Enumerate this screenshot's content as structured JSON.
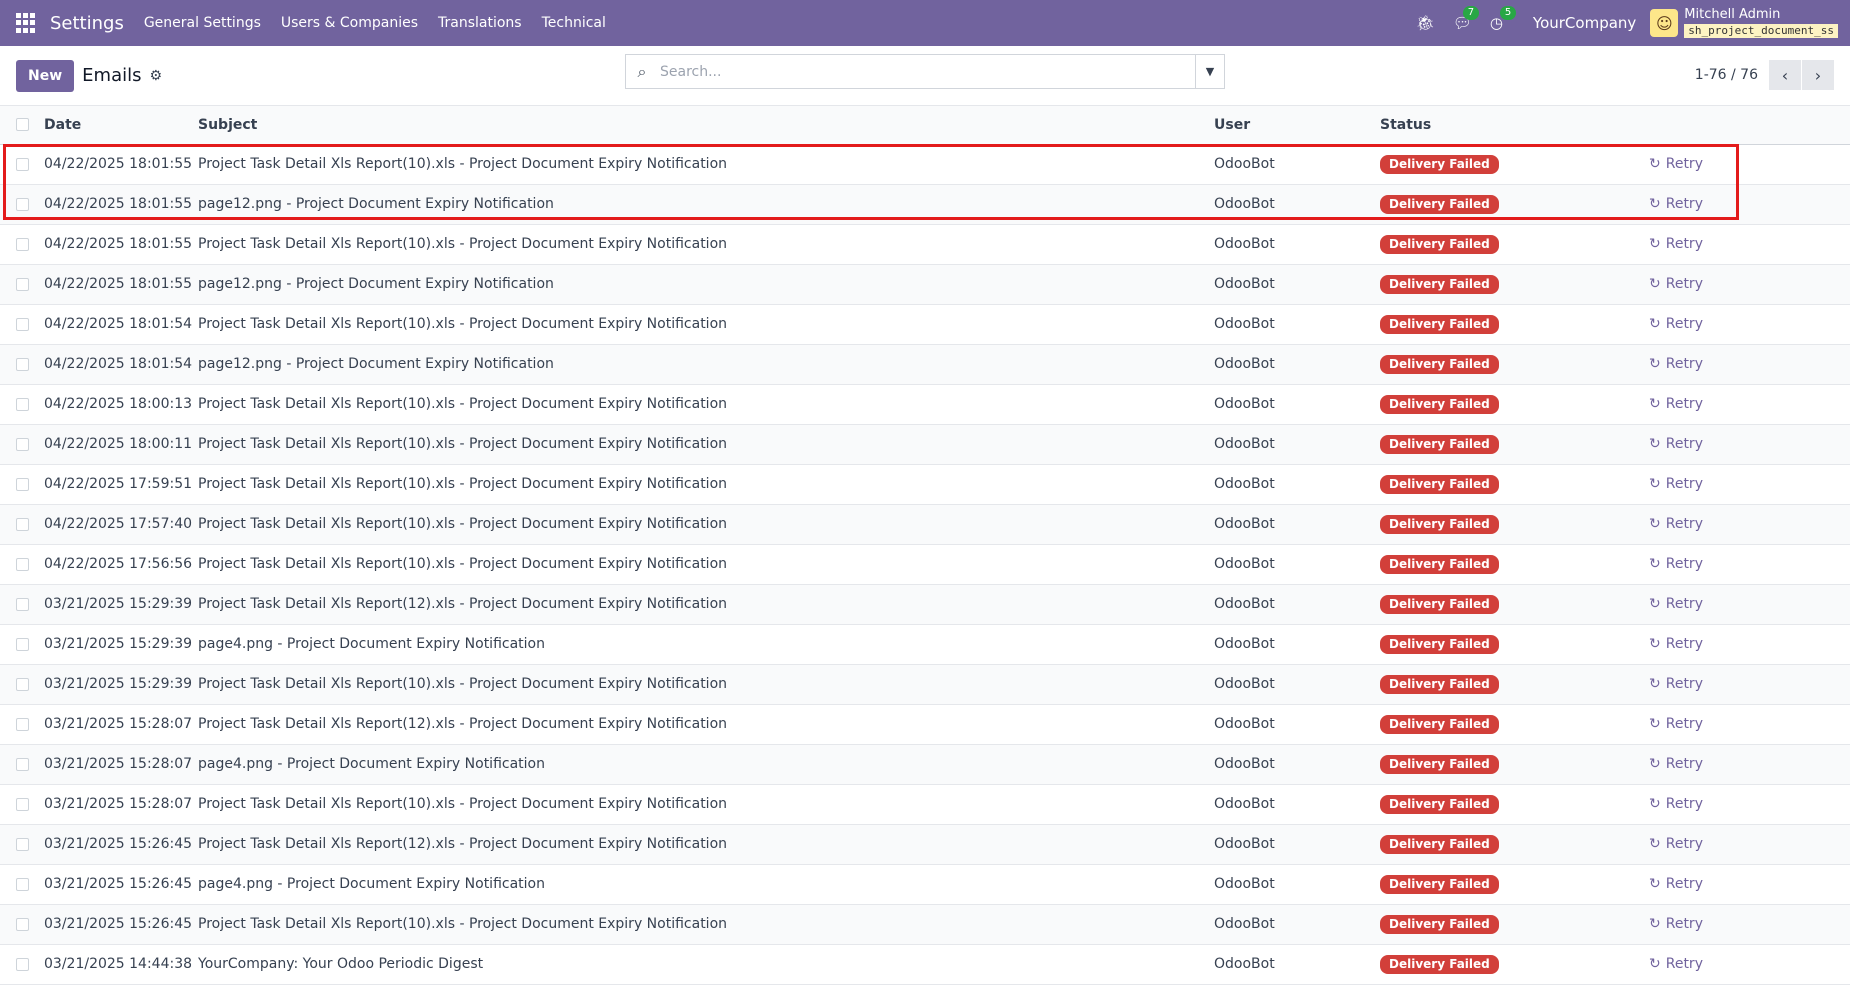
{
  "navbar": {
    "app_title": "Settings",
    "menu": [
      "General Settings",
      "Users & Companies",
      "Translations",
      "Technical"
    ],
    "chat_count": "7",
    "activity_count": "5",
    "company": "YourCompany",
    "user_name": "Mitchell Admin",
    "db_name": "sh_project_document_ss"
  },
  "control": {
    "new_label": "New",
    "title": "Emails",
    "search_placeholder": "Search...",
    "pager": "1-76 / 76"
  },
  "columns": {
    "date": "Date",
    "subject": "Subject",
    "user": "User",
    "status": "Status"
  },
  "rows": [
    {
      "date": "04/22/2025 18:01:55",
      "subject": "Project Task Detail Xls Report(10).xls - Project Document Expiry Notification",
      "user": "OdooBot",
      "status": "Delivery Failed",
      "action": "Retry"
    },
    {
      "date": "04/22/2025 18:01:55",
      "subject": "page12.png - Project Document Expiry Notification",
      "user": "OdooBot",
      "status": "Delivery Failed",
      "action": "Retry"
    },
    {
      "date": "04/22/2025 18:01:55",
      "subject": "Project Task Detail Xls Report(10).xls - Project Document Expiry Notification",
      "user": "OdooBot",
      "status": "Delivery Failed",
      "action": "Retry"
    },
    {
      "date": "04/22/2025 18:01:55",
      "subject": "page12.png - Project Document Expiry Notification",
      "user": "OdooBot",
      "status": "Delivery Failed",
      "action": "Retry"
    },
    {
      "date": "04/22/2025 18:01:54",
      "subject": "Project Task Detail Xls Report(10).xls - Project Document Expiry Notification",
      "user": "OdooBot",
      "status": "Delivery Failed",
      "action": "Retry"
    },
    {
      "date": "04/22/2025 18:01:54",
      "subject": "page12.png - Project Document Expiry Notification",
      "user": "OdooBot",
      "status": "Delivery Failed",
      "action": "Retry"
    },
    {
      "date": "04/22/2025 18:00:13",
      "subject": "Project Task Detail Xls Report(10).xls - Project Document Expiry Notification",
      "user": "OdooBot",
      "status": "Delivery Failed",
      "action": "Retry"
    },
    {
      "date": "04/22/2025 18:00:11",
      "subject": "Project Task Detail Xls Report(10).xls - Project Document Expiry Notification",
      "user": "OdooBot",
      "status": "Delivery Failed",
      "action": "Retry"
    },
    {
      "date": "04/22/2025 17:59:51",
      "subject": "Project Task Detail Xls Report(10).xls - Project Document Expiry Notification",
      "user": "OdooBot",
      "status": "Delivery Failed",
      "action": "Retry"
    },
    {
      "date": "04/22/2025 17:57:40",
      "subject": "Project Task Detail Xls Report(10).xls - Project Document Expiry Notification",
      "user": "OdooBot",
      "status": "Delivery Failed",
      "action": "Retry"
    },
    {
      "date": "04/22/2025 17:56:56",
      "subject": "Project Task Detail Xls Report(10).xls - Project Document Expiry Notification",
      "user": "OdooBot",
      "status": "Delivery Failed",
      "action": "Retry"
    },
    {
      "date": "03/21/2025 15:29:39",
      "subject": "Project Task Detail Xls Report(12).xls - Project Document Expiry Notification",
      "user": "OdooBot",
      "status": "Delivery Failed",
      "action": "Retry"
    },
    {
      "date": "03/21/2025 15:29:39",
      "subject": "page4.png - Project Document Expiry Notification",
      "user": "OdooBot",
      "status": "Delivery Failed",
      "action": "Retry"
    },
    {
      "date": "03/21/2025 15:29:39",
      "subject": "Project Task Detail Xls Report(10).xls - Project Document Expiry Notification",
      "user": "OdooBot",
      "status": "Delivery Failed",
      "action": "Retry"
    },
    {
      "date": "03/21/2025 15:28:07",
      "subject": "Project Task Detail Xls Report(12).xls - Project Document Expiry Notification",
      "user": "OdooBot",
      "status": "Delivery Failed",
      "action": "Retry"
    },
    {
      "date": "03/21/2025 15:28:07",
      "subject": "page4.png - Project Document Expiry Notification",
      "user": "OdooBot",
      "status": "Delivery Failed",
      "action": "Retry"
    },
    {
      "date": "03/21/2025 15:28:07",
      "subject": "Project Task Detail Xls Report(10).xls - Project Document Expiry Notification",
      "user": "OdooBot",
      "status": "Delivery Failed",
      "action": "Retry"
    },
    {
      "date": "03/21/2025 15:26:45",
      "subject": "Project Task Detail Xls Report(12).xls - Project Document Expiry Notification",
      "user": "OdooBot",
      "status": "Delivery Failed",
      "action": "Retry"
    },
    {
      "date": "03/21/2025 15:26:45",
      "subject": "page4.png - Project Document Expiry Notification",
      "user": "OdooBot",
      "status": "Delivery Failed",
      "action": "Retry"
    },
    {
      "date": "03/21/2025 15:26:45",
      "subject": "Project Task Detail Xls Report(10).xls - Project Document Expiry Notification",
      "user": "OdooBot",
      "status": "Delivery Failed",
      "action": "Retry"
    },
    {
      "date": "03/21/2025 14:44:38",
      "subject": "YourCompany: Your Odoo Periodic Digest",
      "user": "OdooBot",
      "status": "Delivery Failed",
      "action": "Retry"
    }
  ],
  "colors": {
    "navbar": "#71639e",
    "failed_badge": "#d23f3a",
    "highlight": "#e31b1b"
  },
  "icons": {
    "apps": "apps-grid-icon",
    "bug": "bug-icon",
    "chat": "chat-icon",
    "activity": "clock-icon",
    "gear": "gear-icon",
    "search": "search-icon",
    "retry": "refresh-icon"
  }
}
